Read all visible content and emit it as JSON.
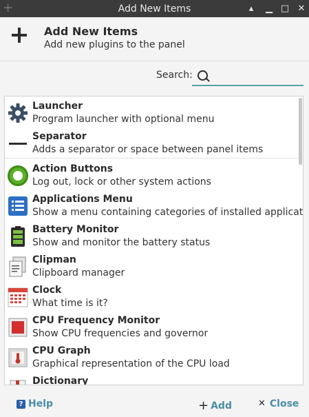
{
  "window": {
    "title": "Add New Items",
    "buttons": {
      "shade": "▴",
      "minimize": "▁",
      "maximize": "□",
      "close": "✕"
    }
  },
  "header": {
    "title": "Add New Items",
    "subtitle": "Add new plugins to the panel"
  },
  "search": {
    "label": "Search:",
    "value": "",
    "placeholder": ""
  },
  "items": [
    {
      "name": "Launcher",
      "desc": "Program launcher with optional menu",
      "icon": "gear-icon"
    },
    {
      "name": "Separator",
      "desc": "Adds a separator or space between panel items",
      "icon": "separator-icon"
    },
    {
      "name": "Action Buttons",
      "desc": "Log out, lock or other system actions",
      "icon": "action-buttons-icon"
    },
    {
      "name": "Applications Menu",
      "desc": "Show a menu containing categories of installed applications",
      "icon": "applications-menu-icon"
    },
    {
      "name": "Battery Monitor",
      "desc": "Show and monitor the battery status",
      "icon": "battery-icon"
    },
    {
      "name": "Clipman",
      "desc": "Clipboard manager",
      "icon": "clipboard-icon"
    },
    {
      "name": "Clock",
      "desc": "What time is it?",
      "icon": "calendar-icon"
    },
    {
      "name": "CPU Frequency Monitor",
      "desc": "Show CPU frequencies and governor",
      "icon": "cpu-freq-icon"
    },
    {
      "name": "CPU Graph",
      "desc": "Graphical representation of the CPU load",
      "icon": "cpu-graph-icon"
    },
    {
      "name": "Dictionary",
      "desc": "",
      "icon": "dictionary-icon"
    }
  ],
  "footer": {
    "help": "Help",
    "add": "Add",
    "close": "Close"
  },
  "colors": {
    "titlebar": "#3b3b3b",
    "accent": "#4a8fa6",
    "search_underline": "#5aa3a3"
  }
}
